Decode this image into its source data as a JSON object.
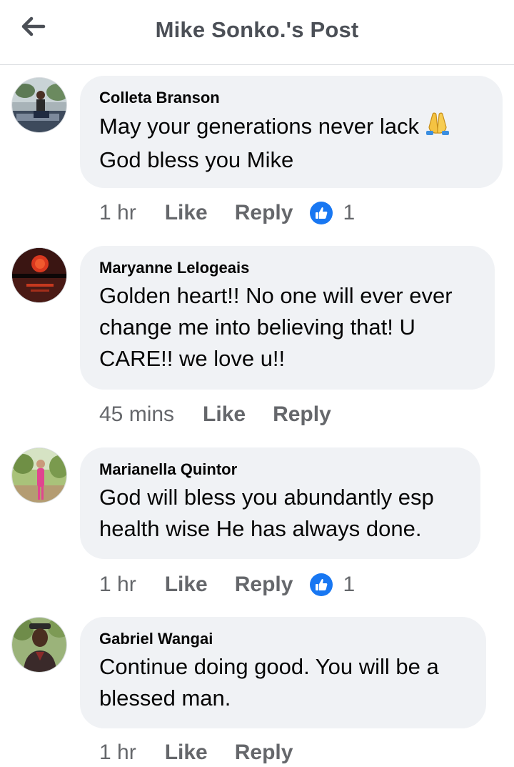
{
  "header": {
    "title": "Mike Sonko.'s Post",
    "back_icon": "arrow-left-icon"
  },
  "comments": [
    {
      "author": "Colleta Branson",
      "lines": [
        "May your generations never lack",
        "God bless you Mike"
      ],
      "emoji": "folded-hands",
      "time": "1 hr",
      "like_label": "Like",
      "reply_label": "Reply",
      "reaction_count": "1"
    },
    {
      "author": "Maryanne Lelogeais",
      "lines": [
        "Golden heart!! No one will ever ever",
        "change me into believing that! U",
        "CARE!! we love u!!"
      ],
      "time": "45 mins",
      "like_label": "Like",
      "reply_label": "Reply"
    },
    {
      "author": "Marianella Quintor",
      "lines": [
        "God will bless you abundantly esp",
        "health wise He has always done."
      ],
      "time": "1 hr",
      "like_label": "Like",
      "reply_label": "Reply",
      "reaction_count": "1"
    },
    {
      "author": "Gabriel Wangai",
      "lines": [
        "Continue doing good. You will be a",
        "blessed man."
      ],
      "time": "1 hr",
      "like_label": "Like",
      "reply_label": "Reply"
    }
  ],
  "colors": {
    "bubble_bg": "#f0f2f5",
    "action_gray": "#65676b",
    "like_blue": "#1877f2"
  }
}
